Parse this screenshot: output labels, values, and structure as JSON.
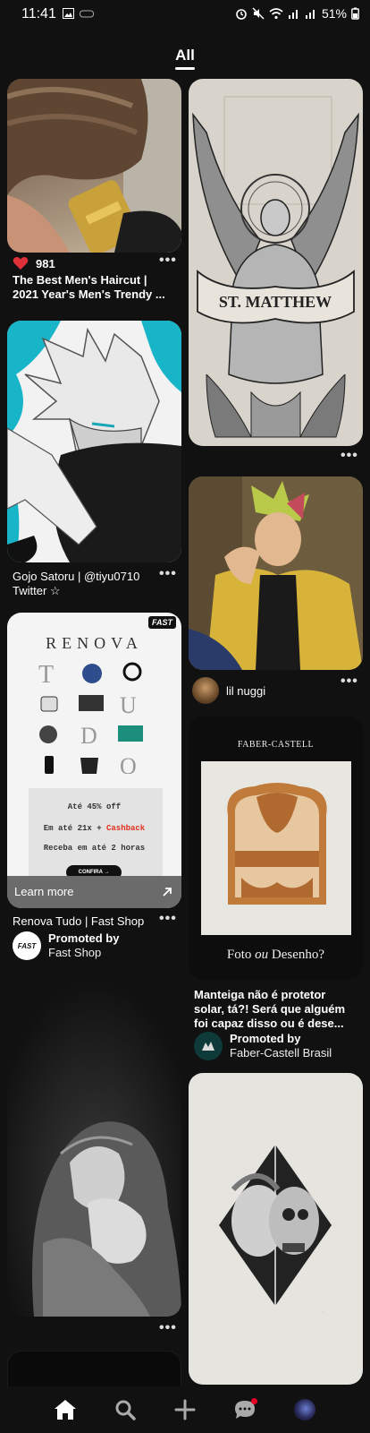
{
  "status": {
    "time": "11:41",
    "battery": "51%",
    "icons": [
      "image-icon",
      "alarm-icon",
      "mute-icon",
      "wifi-icon",
      "signal-icon",
      "signal-icon",
      "battery-icon"
    ]
  },
  "tabs": {
    "active": "All"
  },
  "pins": {
    "haircut": {
      "likes": "981",
      "title_line1": "The Best Men's Haircut |",
      "title_line2": "2021 Year's Men's Trendy ..."
    },
    "gojo": {
      "title_line1": "Gojo Satoru | @tiyu0710",
      "title_line2": "Twitter ☆"
    },
    "renova": {
      "heading": "RENOVA",
      "promo_line1": "Até 45% off",
      "promo_line2_a": "Em até 21x + ",
      "promo_line2_b": "Cashback",
      "promo_line3": "Receba em até 2 horas",
      "cta": "CONFIRA →",
      "brand_badge": "FAST",
      "learn_more": "Learn more",
      "title": "Renova Tudo | Fast Shop",
      "promoted_label": "Promoted by",
      "promoted_name": "Fast Shop",
      "avatar_text": "FAST"
    },
    "angel": {
      "banner_text": "ST. MATTHEW"
    },
    "lil_nuggi": {
      "user": "lil nuggi"
    },
    "faber": {
      "brand": "FABER-CASTELL",
      "caption_a": "Foto ",
      "caption_b": "ou",
      "caption_c": " Desenho?",
      "title_line1": "Manteiga não é protetor",
      "title_line2": "solar, tá?! Será que alguém",
      "title_line3": "foi capaz disso ou é dese...",
      "promoted_label": "Promoted by",
      "promoted_name": "Faber-Castell Brasil"
    }
  },
  "nav": {
    "items": [
      "home-icon",
      "search-icon",
      "plus-icon",
      "chat-icon",
      "profile-avatar"
    ]
  },
  "colors": {
    "background": "#111111",
    "cashback": "#e0301e",
    "notification_dot": "#e60023",
    "like_heart": "#e0303a",
    "cyan_splash": "#18b4c8"
  }
}
